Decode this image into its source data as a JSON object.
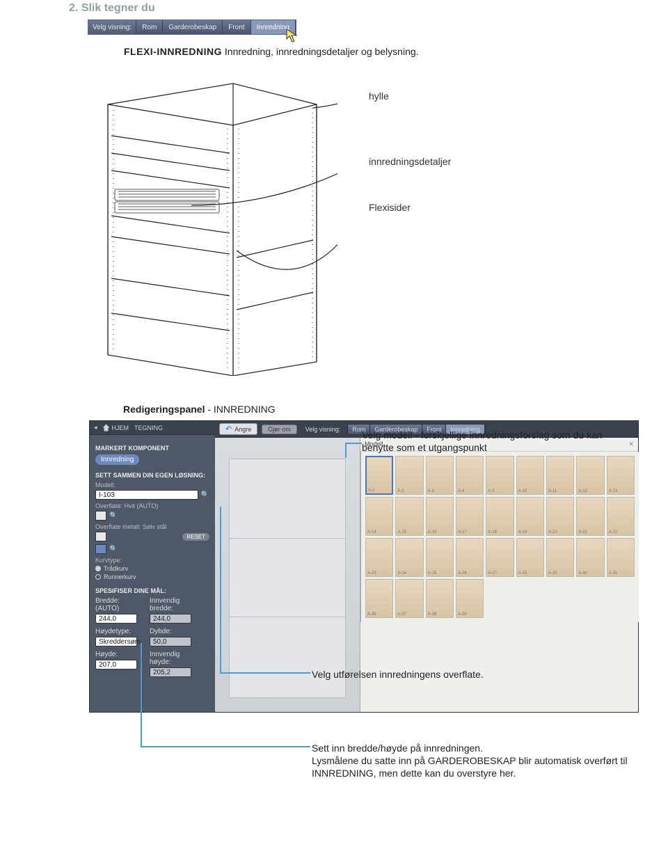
{
  "section_title": "2. Slik tegner du",
  "toolbar": {
    "label": "Velg visning:",
    "tabs": [
      "Rom",
      "Garderobeskap",
      "Front",
      "Innredning"
    ],
    "active_index": 3
  },
  "caption": {
    "bold": "FLEXI-INNREDNING",
    "rest": " Innredning, innredningsdetaljer og belysning."
  },
  "callouts": {
    "hylle": "hylle",
    "innredningsdetaljer": "innredningsdetaljer",
    "flexisider": "Flexisider"
  },
  "panel_title": {
    "bold": "Redigeringspanel",
    "rest": " - INNREDNING"
  },
  "editpanel": {
    "header": {
      "hjem": "HJEM",
      "tegning": "TEGNING"
    },
    "markert_komponent": "MARKERT KOMPONENT",
    "komponent_pill": "Innredning",
    "sett_sammen": "SETT SAMMEN DIN EGEN LØSNING:",
    "modell_label": "Modell:",
    "modell_value": "I-103",
    "overflate_label": "Overflate: Hvit (AUTO)",
    "overflate_metall_label": "Overflate metall: Sølv stål",
    "reset": "RESET",
    "kurvtype_label": "Kurvtype:",
    "kurvtype_options": [
      "Trådkurv",
      "Runnerkurv"
    ],
    "kurvtype_selected": 0,
    "spesifiser": "SPESIFISER DINE MÅL:",
    "dims": {
      "bredde_label": "Bredde: (AUTO)",
      "bredde": "244,0",
      "innv_bredde_label": "Innvendig bredde:",
      "innv_bredde": "244,0",
      "hoyde_type_label": "Høydetype:",
      "hoyde_type": "Skreddersøm",
      "dybde_label": "Dybde:",
      "dybde": "50,0",
      "hoyde_label": "Høyde:",
      "hoyde": "207,0",
      "innv_hoyde_label": "Innvendig høyde:",
      "innv_hoyde": "205,2"
    },
    "right_top": {
      "angre": "Angre",
      "gjor_om": "Gjør om",
      "velg_visning": "Velg visning:",
      "tabs": [
        "Rom",
        "Garderobeskap",
        "Front",
        "Innredning"
      ],
      "active_index": 3
    },
    "gallery_title": "Modell",
    "gallery": [
      "A-1",
      "A-2",
      "A-3",
      "A-4",
      "A-5",
      "A-10",
      "A-11",
      "A-12",
      "A-13",
      "A-14",
      "A-15",
      "A-16",
      "A-17",
      "A-18",
      "A-19",
      "A-20",
      "A-21",
      "A-22",
      "A-23",
      "A-24",
      "A-25",
      "A-26",
      "A-27",
      "A-28",
      "A-29",
      "A-30",
      "A-31",
      "A-36",
      "A-37",
      "A-38",
      "A-39"
    ]
  },
  "notes": {
    "n1": "Velg modell - forskjellige innredningsforslag som du kan benytte som et utgangspunkt",
    "n2": "Velg utførelsen innredningens overflate.",
    "n3": "Sett inn bredde/høyde på innredningen.\nLysmålene du satte inn på GARDEROBESKAP blir automatisk overført til INNREDNING, men dette kan du overstyre her."
  }
}
